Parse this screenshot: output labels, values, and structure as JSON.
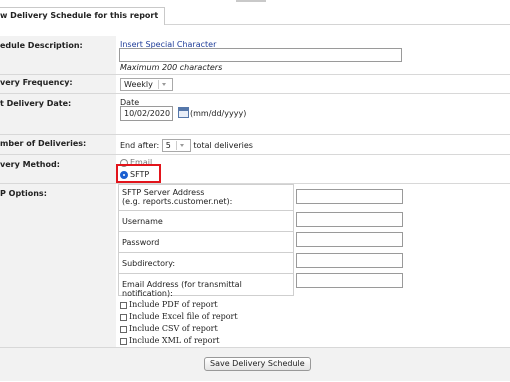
{
  "section_title": "w Delivery Schedule for this report",
  "schedule_description": {
    "label": "edule Description:",
    "link": "Insert Special Character",
    "hint": "Maximum 200 characters"
  },
  "delivery_frequency": {
    "label": "very Frequency:",
    "value": "Weekly"
  },
  "first_delivery_date": {
    "label": "t Delivery Date:",
    "sub_label": "Date",
    "value": "10/02/2020",
    "format": "(mm/dd/yyyy)"
  },
  "number_of_deliveries": {
    "label": "mber of Deliveries:",
    "prefix": "End after:",
    "value": "5",
    "suffix": "total deliveries"
  },
  "delivery_method": {
    "label": "very Method:",
    "options": [
      "Email",
      "SFTP"
    ],
    "selected": "SFTP"
  },
  "sftp_options": {
    "label": "P Options:",
    "fields": [
      {
        "label": "SFTP Server Address",
        "sub": "(e.g. reports.customer.net):",
        "value": ""
      },
      {
        "label": "Username",
        "value": ""
      },
      {
        "label": "Password",
        "value": ""
      },
      {
        "label": "Subdirectory:",
        "value": ""
      },
      {
        "label": "Email Address (for transmittal notification):",
        "value": ""
      }
    ],
    "checkboxes": [
      "Include PDF of report",
      "Include Excel file of report",
      "Include CSV of report",
      "Include XML of report"
    ]
  },
  "save_button": "Save Delivery Schedule",
  "colors": {
    "highlight": "#e2141b",
    "link": "#1f3d99",
    "radio_selected": "#1a5fd1"
  }
}
